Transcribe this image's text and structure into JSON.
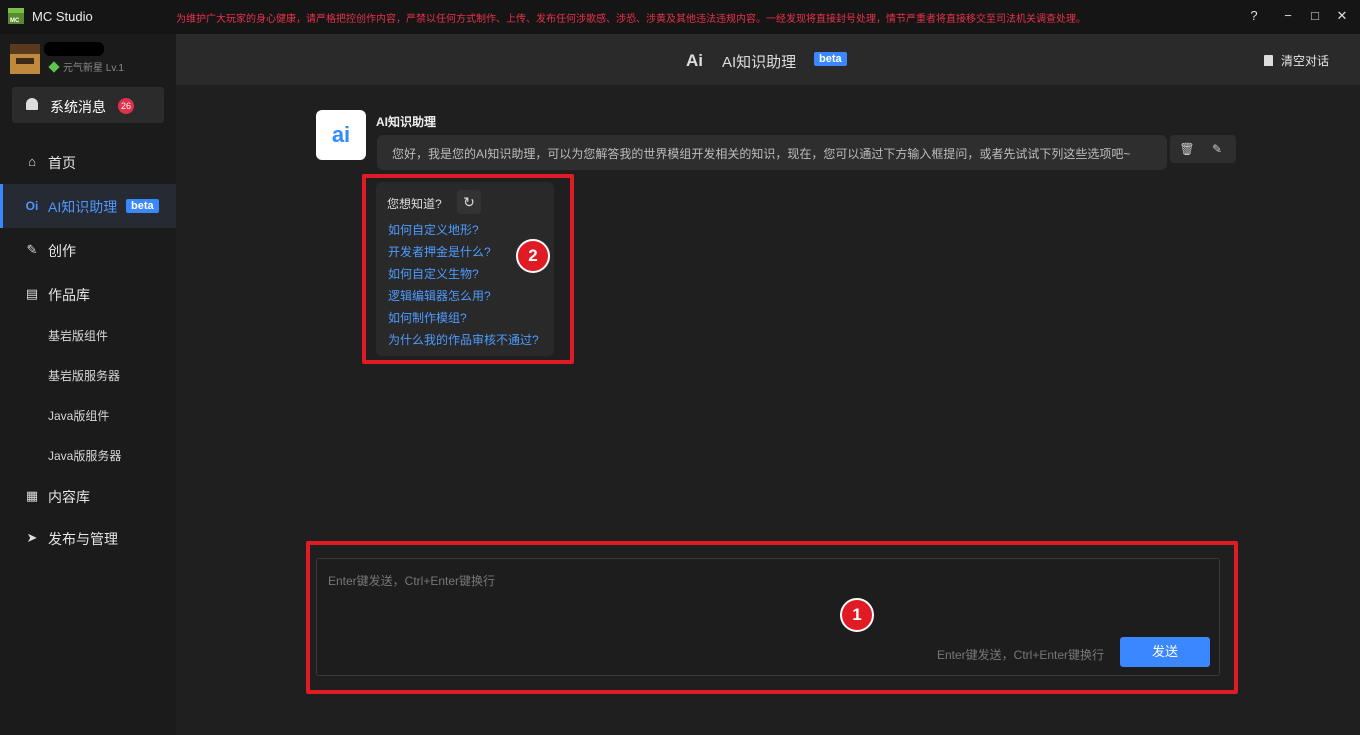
{
  "app": {
    "title": "MC Studio",
    "warning": "为维护广大玩家的身心健康，请严格把控创作内容，严禁以任何方式制作、上传、发布任何涉歌感、涉恐、涉黄及其他违法违规内容。一经发现将直接封号处理，情节严重者将直接移交至司法机关调查处理。",
    "controls": {
      "help": "?",
      "minimize": "−",
      "maximize": "□",
      "close": "✕"
    }
  },
  "user": {
    "level": "元气新星 Lv.1"
  },
  "sidebar": {
    "sysmsg_label": "系统消息",
    "sysmsg_count": "26",
    "items": [
      {
        "label": "首页",
        "icon": "home-icon"
      },
      {
        "label": "AI知识助理",
        "icon": "ai-icon",
        "badge": "beta"
      },
      {
        "label": "创作",
        "icon": "pencil-icon"
      },
      {
        "label": "作品库",
        "icon": "library-icon"
      },
      {
        "label": "内容库",
        "icon": "grid-icon"
      },
      {
        "label": "发布与管理",
        "icon": "paper-plane-icon"
      }
    ],
    "subitems": [
      "基岩版组件",
      "基岩版服务器",
      "Java版组件",
      "Java版服务器"
    ]
  },
  "header": {
    "logo": "Ai",
    "title": "AI知识助理",
    "badge": "beta",
    "clear_label": "清空对话"
  },
  "chat": {
    "bot_avatar": "ai",
    "bot_name": "AI知识助理",
    "message": "您好，我是您的AI知识助理，可以为您解答我的世界模组开发相关的知识，现在，您可以通过下方输入框提问，或者先试试下列这些选项吧~"
  },
  "suggest": {
    "header": "您想知道?",
    "questions": [
      "如何自定义地形?",
      "开发者押金是什么?",
      "如何自定义生物?",
      "逻辑编辑器怎么用?",
      "如何制作模组?",
      "为什么我的作品审核不通过?"
    ]
  },
  "input": {
    "placeholder": "Enter键发送，Ctrl+Enter键换行",
    "hint": "Enter键发送，Ctrl+Enter键换行",
    "send_label": "发送"
  },
  "annotations": {
    "one": "1",
    "two": "2"
  },
  "colors": {
    "accent": "#3b87ff",
    "highlight": "#e01b24",
    "link": "#4d9bff"
  }
}
